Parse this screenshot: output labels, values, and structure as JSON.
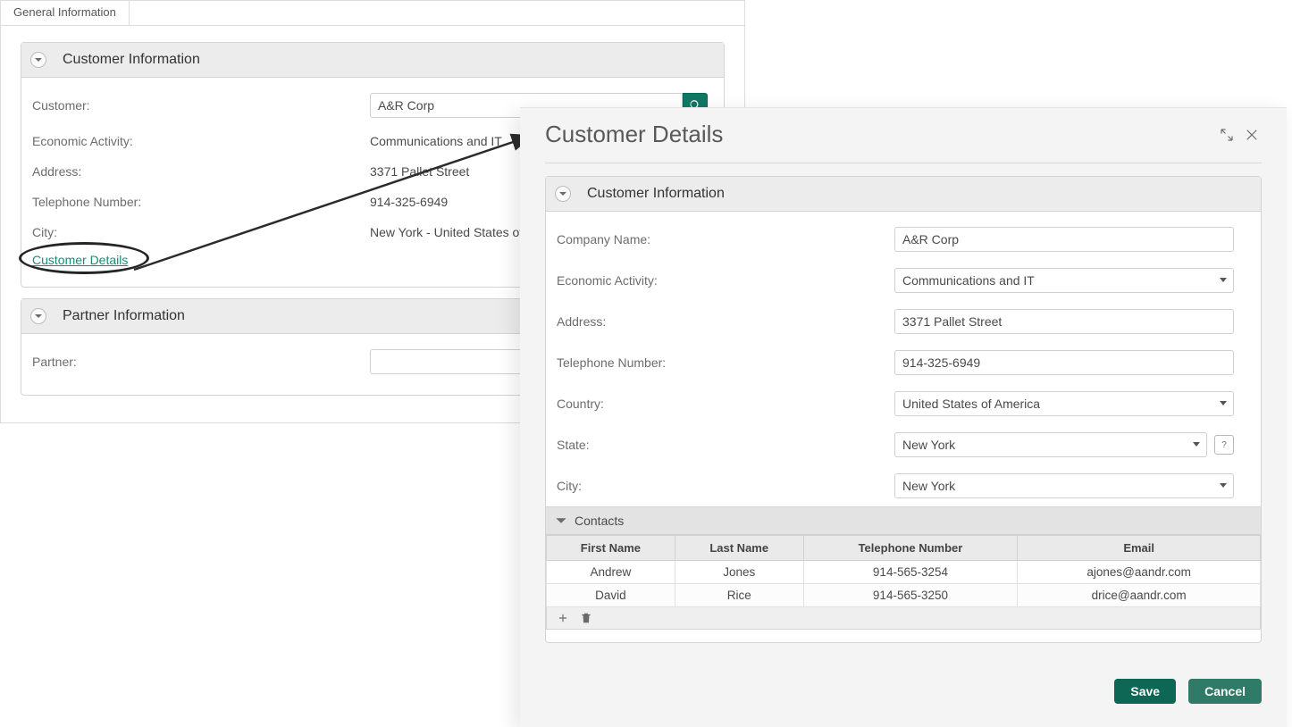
{
  "tabs": {
    "general": "General Information"
  },
  "back": {
    "customerInfo": {
      "title": "Customer Information",
      "labels": {
        "customer": "Customer:",
        "economic": "Economic Activity:",
        "address": "Address:",
        "telephone": "Telephone Number:",
        "city": "City:"
      },
      "values": {
        "customer": "A&R Corp",
        "economic": "Communications and IT",
        "address": "3371 Pallet Street",
        "telephone": "914-325-6949",
        "city": "New York - United States of A"
      },
      "detailsLink": "Customer Details"
    },
    "partnerInfo": {
      "title": "Partner Information",
      "labels": {
        "partner": "Partner:"
      },
      "values": {
        "partner": ""
      }
    }
  },
  "modal": {
    "title": "Customer Details",
    "section": {
      "title": "Customer Information",
      "labels": {
        "company": "Company Name:",
        "economic": "Economic Activity:",
        "address": "Address:",
        "telephone": "Telephone Number:",
        "country": "Country:",
        "state": "State:",
        "city": "City:"
      },
      "values": {
        "company": "A&R Corp",
        "economic": "Communications and IT",
        "address": "3371 Pallet Street",
        "telephone": "914-325-6949",
        "country": "United States of America",
        "state": "New York",
        "city": "New York"
      }
    },
    "contacts": {
      "title": "Contacts",
      "headers": {
        "first": "First Name",
        "last": "Last Name",
        "phone": "Telephone Number",
        "email": "Email"
      },
      "rows": [
        {
          "first": "Andrew",
          "last": "Jones",
          "phone": "914-565-3254",
          "email": "ajones@aandr.com"
        },
        {
          "first": "David",
          "last": "Rice",
          "phone": "914-565-3250",
          "email": "drice@aandr.com"
        }
      ]
    },
    "buttons": {
      "save": "Save",
      "cancel": "Cancel"
    }
  }
}
